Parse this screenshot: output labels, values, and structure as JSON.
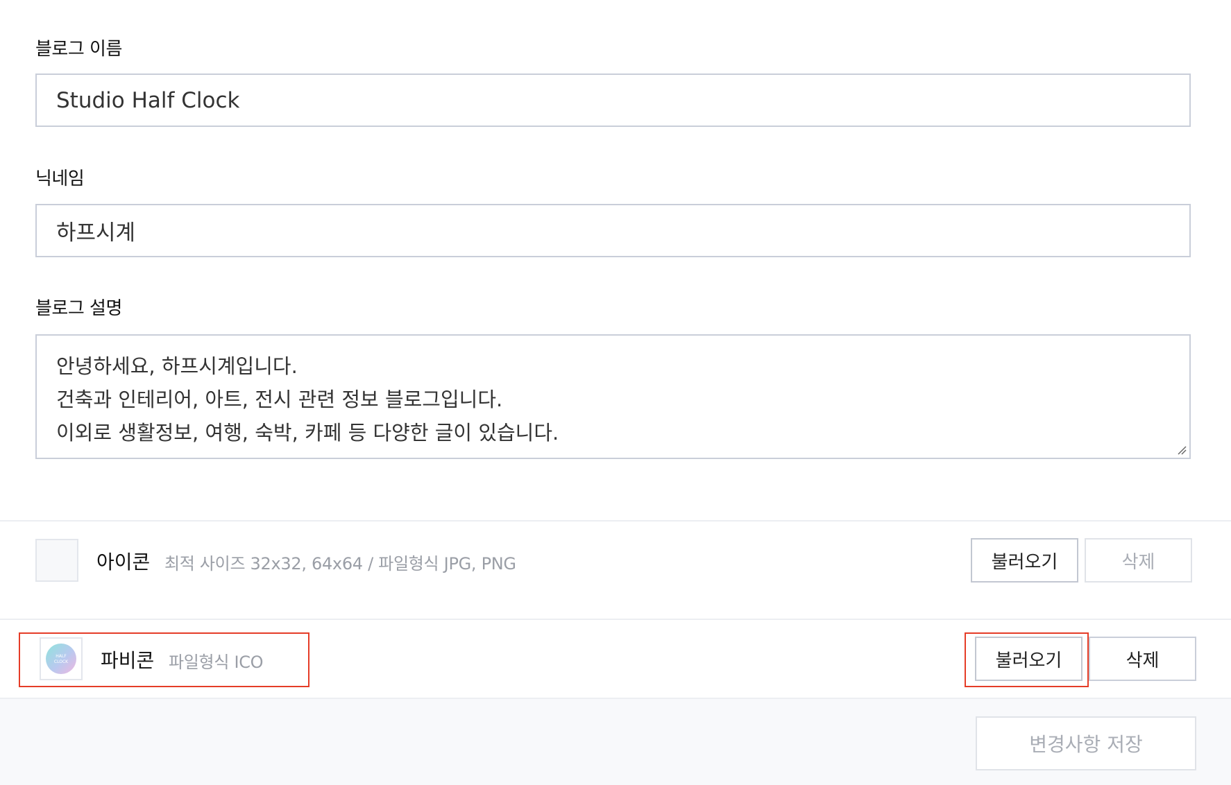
{
  "blog_name": {
    "label": "블로그 이름",
    "value": "Studio Half Clock"
  },
  "nickname": {
    "label": "닉네임",
    "value": "하프시계"
  },
  "description": {
    "label": "블로그 설명",
    "lines": [
      "안녕하세요, 하프시계입니다.",
      "건축과 인테리어, 아트, 전시 관련 정보 블로그입니다.",
      "이외로 생활정보, 여행, 숙박, 카페 등 다양한 글이 있습니다."
    ]
  },
  "icon_row": {
    "title": "아이콘",
    "hint": "최적 사이즈 32x32, 64x64 / 파일형식 JPG, PNG",
    "load_label": "불러오기",
    "delete_label": "삭제"
  },
  "favicon_row": {
    "title": "파비콘",
    "hint": "파일형식 ICO",
    "thumb_text_line1": "HALF",
    "thumb_text_line2": "CLOCK",
    "load_label": "불러오기",
    "delete_label": "삭제"
  },
  "footer": {
    "save_label": "변경사항 저장"
  },
  "colors": {
    "highlight": "#e53c27",
    "border": "#c9ced9",
    "muted_text": "#a9adb5"
  }
}
